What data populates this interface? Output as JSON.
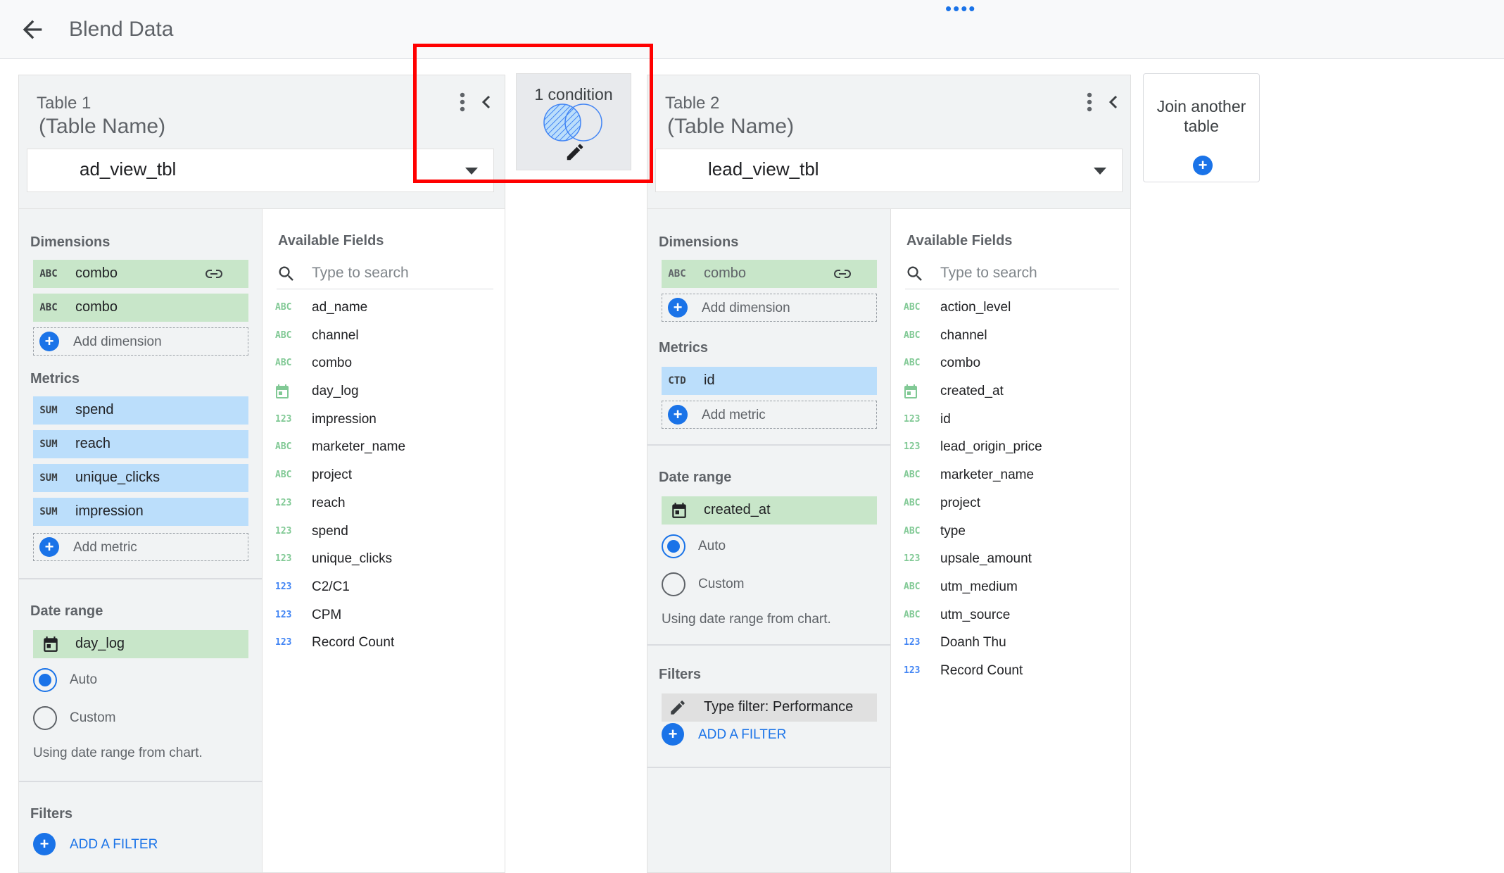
{
  "header": {
    "title": "Blend Data",
    "back_icon": "arrow-back-icon"
  },
  "join": {
    "label": "1 condition",
    "venn_icon": "venn-diagram-icon",
    "edit_icon": "pencil-icon"
  },
  "table1": {
    "label": "Table 1",
    "name": "(Table Name)",
    "source": "ad_view_tbl",
    "dimensions_heading": "Dimensions",
    "dimensions": [
      {
        "tag": "ABC",
        "name": "combo",
        "linked": true
      },
      {
        "tag": "ABC",
        "name": "combo",
        "linked": false
      }
    ],
    "add_dimension": "Add dimension",
    "metrics_heading": "Metrics",
    "metrics": [
      {
        "tag": "SUM",
        "name": "spend"
      },
      {
        "tag": "SUM",
        "name": "reach"
      },
      {
        "tag": "SUM",
        "name": "unique_clicks"
      },
      {
        "tag": "SUM",
        "name": "impression"
      }
    ],
    "add_metric": "Add metric",
    "date_range_heading": "Date range",
    "date_field": "day_log",
    "auto_label": "Auto",
    "custom_label": "Custom",
    "date_note": "Using date range from chart.",
    "filters_heading": "Filters",
    "add_filter": "ADD A FILTER",
    "available_heading": "Available Fields",
    "search_placeholder": "Type to search",
    "fields": [
      {
        "type": "abc",
        "tag": "ABC",
        "name": "ad_name"
      },
      {
        "type": "abc",
        "tag": "ABC",
        "name": "channel"
      },
      {
        "type": "abc",
        "tag": "ABC",
        "name": "combo"
      },
      {
        "type": "date",
        "tag": "",
        "name": "day_log"
      },
      {
        "type": "num",
        "tag": "123",
        "name": "impression"
      },
      {
        "type": "abc",
        "tag": "ABC",
        "name": "marketer_name"
      },
      {
        "type": "abc",
        "tag": "ABC",
        "name": "project"
      },
      {
        "type": "num",
        "tag": "123",
        "name": "reach"
      },
      {
        "type": "num",
        "tag": "123",
        "name": "spend"
      },
      {
        "type": "num",
        "tag": "123",
        "name": "unique_clicks"
      },
      {
        "type": "calc",
        "tag": "123",
        "name": "C2/C1"
      },
      {
        "type": "calc",
        "tag": "123",
        "name": "CPM"
      },
      {
        "type": "calc",
        "tag": "123",
        "name": "Record Count"
      }
    ]
  },
  "table2": {
    "label": "Table 2",
    "name": "(Table Name)",
    "source": "lead_view_tbl",
    "dimensions_heading": "Dimensions",
    "dimensions": [
      {
        "tag": "ABC",
        "name": "combo",
        "linked": true
      }
    ],
    "add_dimension": "Add dimension",
    "metrics_heading": "Metrics",
    "metrics": [
      {
        "tag": "CTD",
        "name": "id"
      }
    ],
    "add_metric": "Add metric",
    "date_range_heading": "Date range",
    "date_field": "created_at",
    "auto_label": "Auto",
    "custom_label": "Custom",
    "date_note": "Using date range from chart.",
    "filters_heading": "Filters",
    "filter_chip": "Type filter: Performance",
    "add_filter": "ADD A FILTER",
    "available_heading": "Available Fields",
    "search_placeholder": "Type to search",
    "fields": [
      {
        "type": "abc",
        "tag": "ABC",
        "name": "action_level"
      },
      {
        "type": "abc",
        "tag": "ABC",
        "name": "channel"
      },
      {
        "type": "abc",
        "tag": "ABC",
        "name": "combo"
      },
      {
        "type": "date",
        "tag": "",
        "name": "created_at"
      },
      {
        "type": "num",
        "tag": "123",
        "name": "id"
      },
      {
        "type": "num",
        "tag": "123",
        "name": "lead_origin_price"
      },
      {
        "type": "abc",
        "tag": "ABC",
        "name": "marketer_name"
      },
      {
        "type": "abc",
        "tag": "ABC",
        "name": "project"
      },
      {
        "type": "abc",
        "tag": "ABC",
        "name": "type"
      },
      {
        "type": "num",
        "tag": "123",
        "name": "upsale_amount"
      },
      {
        "type": "abc",
        "tag": "ABC",
        "name": "utm_medium"
      },
      {
        "type": "abc",
        "tag": "ABC",
        "name": "utm_source"
      },
      {
        "type": "calc",
        "tag": "123",
        "name": "Doanh Thu"
      },
      {
        "type": "calc",
        "tag": "123",
        "name": "Record Count"
      }
    ]
  },
  "join_another": {
    "label": "Join another table"
  },
  "colors": {
    "accent": "#1a73e8",
    "dimension_chip": "#c8e6c9",
    "metric_chip": "#bbdefb",
    "highlight": "#ff0000"
  }
}
